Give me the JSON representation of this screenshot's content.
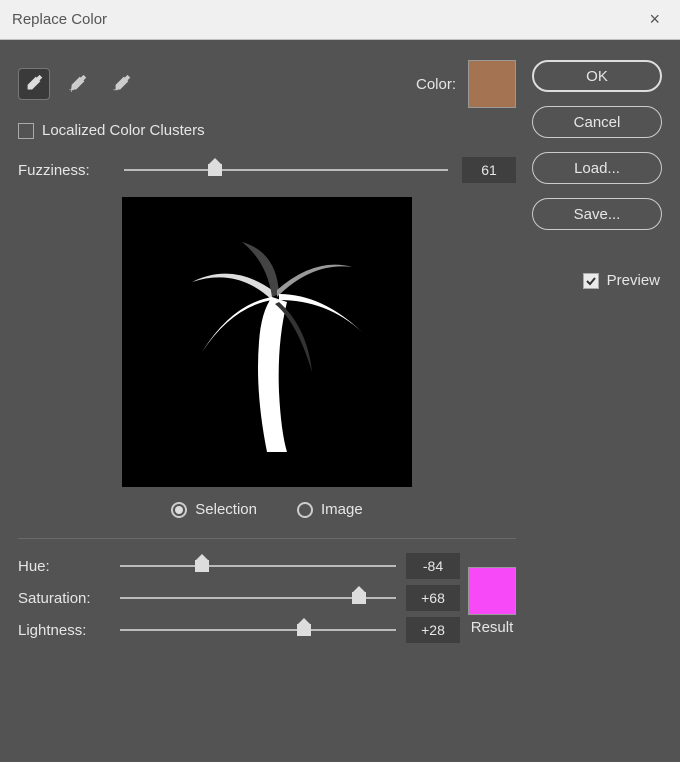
{
  "title": "Replace Color",
  "localized_label": "Localized Color Clusters",
  "localized_checked": false,
  "color_label": "Color:",
  "color_swatch": "#a47352",
  "fuzziness_label": "Fuzziness:",
  "fuzziness_value": "61",
  "fuzziness_percent": 26,
  "radio": {
    "selection": "Selection",
    "image": "Image",
    "selected": "selection"
  },
  "hue_label": "Hue:",
  "hue_value": "-84",
  "hue_percent": 27,
  "saturation_label": "Saturation:",
  "saturation_value": "+68",
  "saturation_percent": 84,
  "lightness_label": "Lightness:",
  "lightness_value": "+28",
  "lightness_percent": 64,
  "result_label": "Result",
  "result_swatch": "#f749f7",
  "buttons": {
    "ok": "OK",
    "cancel": "Cancel",
    "load": "Load...",
    "save": "Save..."
  },
  "preview_label": "Preview",
  "preview_checked": true
}
